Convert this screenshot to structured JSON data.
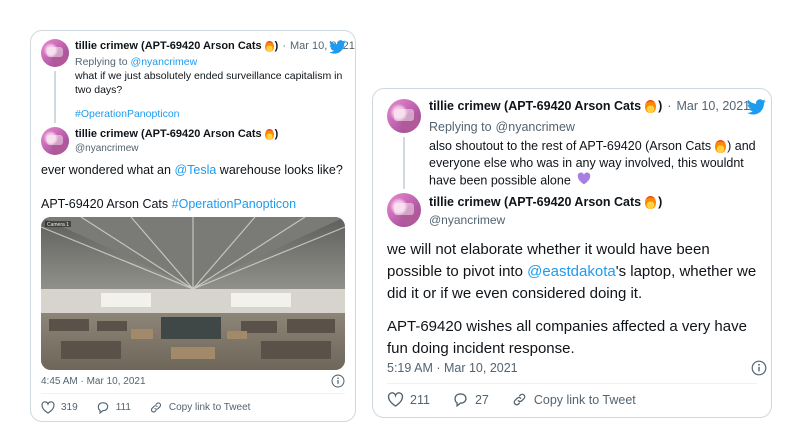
{
  "colors": {
    "link": "#1d9bf0",
    "muted": "#536471",
    "border": "#cfd9de"
  },
  "tweet_left": {
    "parent": {
      "name": "tillie crimew (APT-69420 Arson Cats",
      "name_close": ")",
      "date_sep": "·",
      "date": "Mar 10, 2021",
      "reply_prefix": "Replying to",
      "reply_to": "@nyancrimew",
      "text": "what if we just absolutely ended surveillance capitalism in two days?",
      "hashtag": "#OperationPanopticon"
    },
    "main": {
      "name": "tillie crimew (APT-69420 Arson Cats",
      "name_close": ")",
      "handle": "@nyancrimew",
      "text_before": "ever wondered what an",
      "mention": "@Tesla",
      "text_after": "warehouse looks like?",
      "signature": "APT-69420 Arson Cats",
      "hashtag": "#OperationPanopticon",
      "photo_label": "Camera 1",
      "time": "4:45 AM · Mar 10, 2021",
      "likes": "319",
      "replies": "111",
      "copy_link": "Copy link to Tweet"
    }
  },
  "tweet_right": {
    "parent": {
      "name": "tillie crimew (APT-69420 Arson Cats",
      "name_close": ")",
      "date_sep": "·",
      "date": "Mar 10, 2021",
      "reply_prefix": "Replying to",
      "reply_to": "@nyancrimew",
      "text_a": "also shoutout to the rest of APT-69420 (Arson Cats",
      "text_b": ") and everyone else who was in any way involved, this wouldnt have been possible alone"
    },
    "main": {
      "name": "tillie crimew (APT-69420 Arson Cats",
      "name_close": ")",
      "handle": "@nyancrimew",
      "text_a": "we will not elaborate whether it would have been possible to pivot into",
      "mention": "@eastdakota",
      "text_b": "'s laptop, whether we did it or if we even considered doing it.",
      "text_c": "APT-69420 wishes all companies affected a very have fun doing incident response.",
      "time": "5:19 AM · Mar 10, 2021",
      "likes": "211",
      "replies": "27",
      "copy_link": "Copy link to Tweet"
    }
  },
  "icons": [
    "twitter-bird-icon",
    "fire-emoji-icon",
    "purple-heart-icon",
    "heart-icon",
    "reply-icon",
    "link-icon",
    "info-icon"
  ]
}
